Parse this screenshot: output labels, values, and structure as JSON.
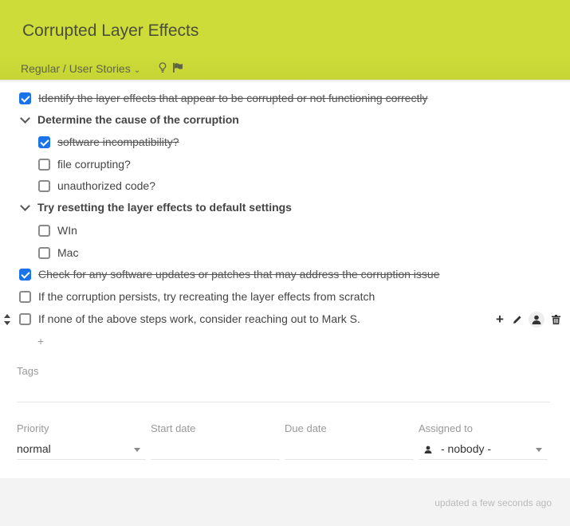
{
  "header": {
    "title": "Corrupted Layer Effects",
    "board_path": "Regular / User Stories",
    "board_chevron": "⌄",
    "icons": [
      "lightbulb-icon",
      "flag-icon"
    ]
  },
  "checklist": [
    {
      "type": "item",
      "level": 0,
      "checked": true,
      "text": "Identify the layer effects that appear to be corrupted or not functioning correctly"
    },
    {
      "type": "group",
      "level": 0,
      "expanded": true,
      "text": "Determine the cause of the corruption"
    },
    {
      "type": "item",
      "level": 1,
      "checked": true,
      "text": "software incompatibility?"
    },
    {
      "type": "item",
      "level": 1,
      "checked": false,
      "text": "file corrupting?"
    },
    {
      "type": "item",
      "level": 1,
      "checked": false,
      "text": "unauthorized code?"
    },
    {
      "type": "group",
      "level": 0,
      "expanded": true,
      "text": "Try resetting the layer effects to default settings"
    },
    {
      "type": "item",
      "level": 1,
      "checked": false,
      "text": "WIn"
    },
    {
      "type": "item",
      "level": 1,
      "checked": false,
      "text": "Mac"
    },
    {
      "type": "item",
      "level": 0,
      "checked": true,
      "text": "Check for any software updates or patches that may address the corruption issue"
    },
    {
      "type": "item",
      "level": 0,
      "checked": false,
      "text": "If the corruption persists, try recreating the layer effects from scratch"
    },
    {
      "type": "item",
      "level": 0,
      "checked": false,
      "text": "If none of the above steps work, consider reaching out to Mark S.",
      "hovered": true
    }
  ],
  "row_actions": {
    "add": "+",
    "icons": [
      "add-icon",
      "edit-icon",
      "assign-user-icon",
      "trash-icon"
    ]
  },
  "add_subtask": "+",
  "tags": {
    "label": "Tags"
  },
  "fields": {
    "priority": {
      "label": "Priority",
      "value": "normal"
    },
    "start_date": {
      "label": "Start date",
      "value": ""
    },
    "due_date": {
      "label": "Due date",
      "value": ""
    },
    "assigned_to": {
      "label": "Assigned to",
      "value": "- nobody -"
    }
  },
  "footer": {
    "updated": "updated a few seconds ago"
  },
  "colors": {
    "header": "#cddc39",
    "checkbox_checked": "#1a73e8"
  }
}
